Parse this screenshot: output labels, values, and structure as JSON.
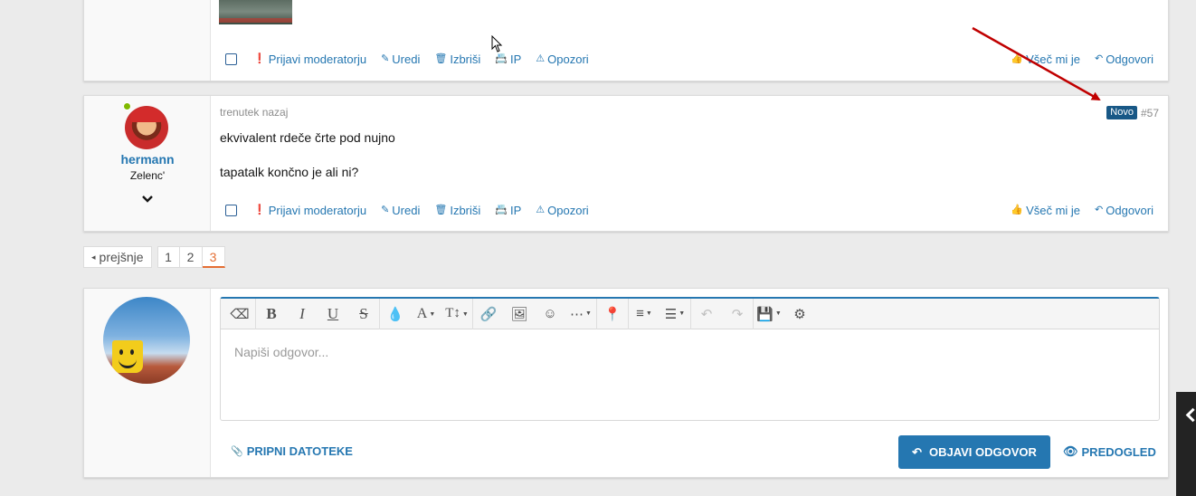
{
  "actions": {
    "report": "Prijavi moderatorju",
    "edit": "Uredi",
    "delete": "Izbriši",
    "ip": "IP",
    "warn": "Opozori",
    "like": "Všeč mi je",
    "reply": "Odgovori"
  },
  "post": {
    "time": "trenutek nazaj",
    "new_badge": "Novo",
    "number": "#57",
    "username": "hermann",
    "user_title": "Zelenc'",
    "lines": [
      "ekvivalent rdeče črte pod nujno",
      "tapatalk končno je ali ni?"
    ]
  },
  "pagination": {
    "prev": "prejšnje",
    "pages": [
      "1",
      "2",
      "3"
    ],
    "current": "3"
  },
  "reply_form": {
    "placeholder": "Napiši odgovor...",
    "attach": "PRIPNI DATOTEKE",
    "submit": "OBJAVI ODGOVOR",
    "preview": "PREDOGLED"
  },
  "colors": {
    "link": "#2577b1",
    "new_badge": "#185886",
    "current_page": "#e46e33",
    "annotation_arrow": "#c00000",
    "online": "#7fb900"
  },
  "toolbar_icons": [
    "eraser-icon",
    "bold-icon",
    "italic-icon",
    "underline-icon",
    "strike-icon",
    "color-icon",
    "font-family-icon",
    "font-size-icon",
    "link-icon",
    "image-icon",
    "smilie-icon",
    "more-icon",
    "map-marker-icon",
    "align-icon",
    "list-icon",
    "undo-icon",
    "redo-icon",
    "drafts-icon",
    "settings-icon"
  ]
}
